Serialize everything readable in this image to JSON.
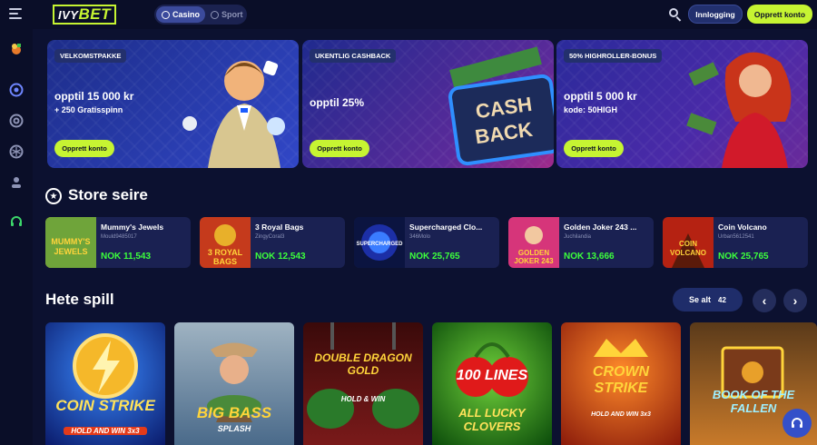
{
  "header": {
    "logo_part1": "IVY",
    "logo_part2": "BET",
    "switch": [
      {
        "label": "Casino",
        "active": true
      },
      {
        "label": "Sport",
        "active": false
      }
    ],
    "login_label": "Innlogging",
    "signup_label": "Opprett konto"
  },
  "sidebar": {
    "items": [
      "promo-icon",
      "casino-icon",
      "live-casino-icon",
      "sport-icon",
      "profile-icon",
      "support-icon"
    ]
  },
  "promos": [
    {
      "tag": "VELKOMSTPAKKE",
      "line1": "opptil 15 000 kr",
      "line2": "+ 250 Gratisspinn",
      "cta": "Opprett konto",
      "bg": "#2a3aa8"
    },
    {
      "tag": "UKENTLIG CASHBACK",
      "line1": "opptil 25%",
      "line2": "",
      "cta": "Opprett konto",
      "art": "CASH BACK",
      "bg": "#4a2a9a"
    },
    {
      "tag": "50% HIGHROLLER-BONUS",
      "line1": "opptil 5 000 kr",
      "line2": "kode: 50HIGH",
      "cta": "Opprett konto",
      "bg": "#3b2aa0"
    }
  ],
  "big_wins": {
    "title": "Store seire",
    "items": [
      {
        "name": "Mummy's Jewels",
        "user": "Mould9485017",
        "amount": "NOK 11,543",
        "art": "MUMMY'S JEWELS",
        "color": "#b8842a"
      },
      {
        "name": "3 Royal Bags",
        "user": "ZingyCoral3",
        "amount": "NOK 12,543",
        "art": "3 ROYAL BAGS",
        "color": "#c53a1c"
      },
      {
        "name": "Supercharged Clo...",
        "user": "346Molo",
        "amount": "NOK 25,765",
        "art": "SUPERCHARGED CLOVERS",
        "color": "#1c2fa6"
      },
      {
        "name": "Golden Joker 243 ...",
        "user": "Juchilandia",
        "amount": "NOK 13,666",
        "art": "GOLDEN JOKER 243",
        "color": "#d6357a"
      },
      {
        "name": "Coin Volcano",
        "user": "Urban5612541",
        "amount": "NOK 25,765",
        "art": "COIN VOLCANO",
        "color": "#b52212"
      }
    ]
  },
  "hot_games": {
    "title": "Hete spill",
    "see_all_label": "Se alt",
    "count": "42",
    "prev": "‹",
    "next": "›",
    "games": [
      {
        "title": "COIN STRIKE",
        "sub": "HOLD AND WIN 3x3",
        "bg": "#123a9a"
      },
      {
        "title": "BIG BASS",
        "sub": "SPLASH",
        "bg": "#6a7d8f"
      },
      {
        "title": "DOUBLE DRAGON GOLD",
        "sub": "HOLD & WIN",
        "bg": "#5a1414"
      },
      {
        "title": "100 LINES",
        "sub": "ALL LUCKY CLOVERS",
        "bg": "#1a6e1a"
      },
      {
        "title": "CROWN STRIKE",
        "sub": "HOLD AND WIN 3x3",
        "bg": "#b52a12"
      },
      {
        "title": "BOOK OF THE FALLEN",
        "sub": "",
        "bg": "#8a4a1a"
      }
    ]
  }
}
